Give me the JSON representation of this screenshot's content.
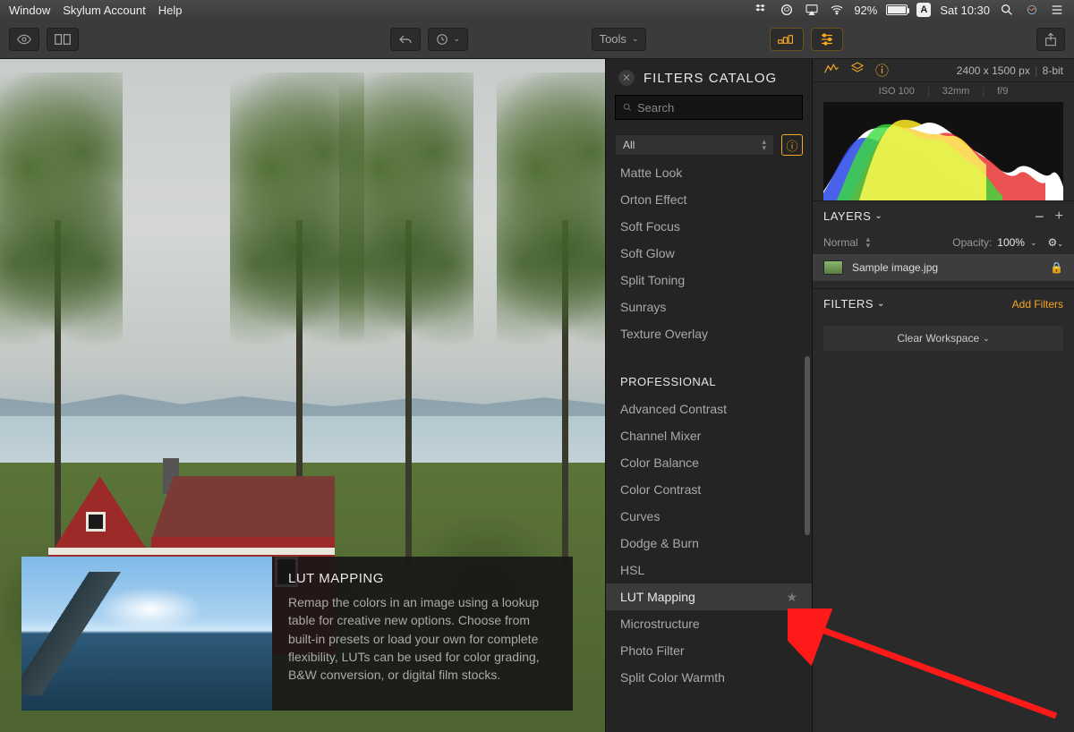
{
  "menubar": {
    "items": [
      "Window",
      "Skylum Account",
      "Help"
    ],
    "battery_pct": "92%",
    "input_indicator": "A",
    "clock": "Sat 10:30"
  },
  "toolbar": {
    "tools_label": "Tools"
  },
  "catalog": {
    "title": "FILTERS CATALOG",
    "search_placeholder": "Search",
    "category_selected": "All",
    "pre_items": [
      "Matte Look",
      "Orton Effect",
      "Soft Focus",
      "Soft Glow",
      "Split Toning",
      "Sunrays",
      "Texture Overlay"
    ],
    "section": "PROFESSIONAL",
    "pro_items": [
      "Advanced Contrast",
      "Channel Mixer",
      "Color Balance",
      "Color Contrast",
      "Curves",
      "Dodge & Burn",
      "HSL",
      "LUT Mapping",
      "Microstructure",
      "Photo Filter",
      "Split Color Warmth"
    ],
    "selected": "LUT Mapping"
  },
  "tooltip": {
    "title": "LUT MAPPING",
    "body": "Remap the colors in an image using a lookup table for creative new options. Choose from built-in presets or load your own for complete flexibility, LUTs can be used for color grading, B&W conversion, or digital film stocks."
  },
  "rightpanel": {
    "dimensions": "2400 x 1500 px",
    "bitdepth": "8-bit",
    "meta": {
      "iso": "ISO 100",
      "focal": "32mm",
      "aperture": "f/9"
    },
    "layers": {
      "title": "LAYERS",
      "blend": "Normal",
      "opacity_label": "Opacity:",
      "opacity_value": "100%",
      "item": "Sample image.jpg"
    },
    "filters": {
      "title": "FILTERS",
      "add": "Add Filters",
      "clear": "Clear Workspace"
    }
  }
}
